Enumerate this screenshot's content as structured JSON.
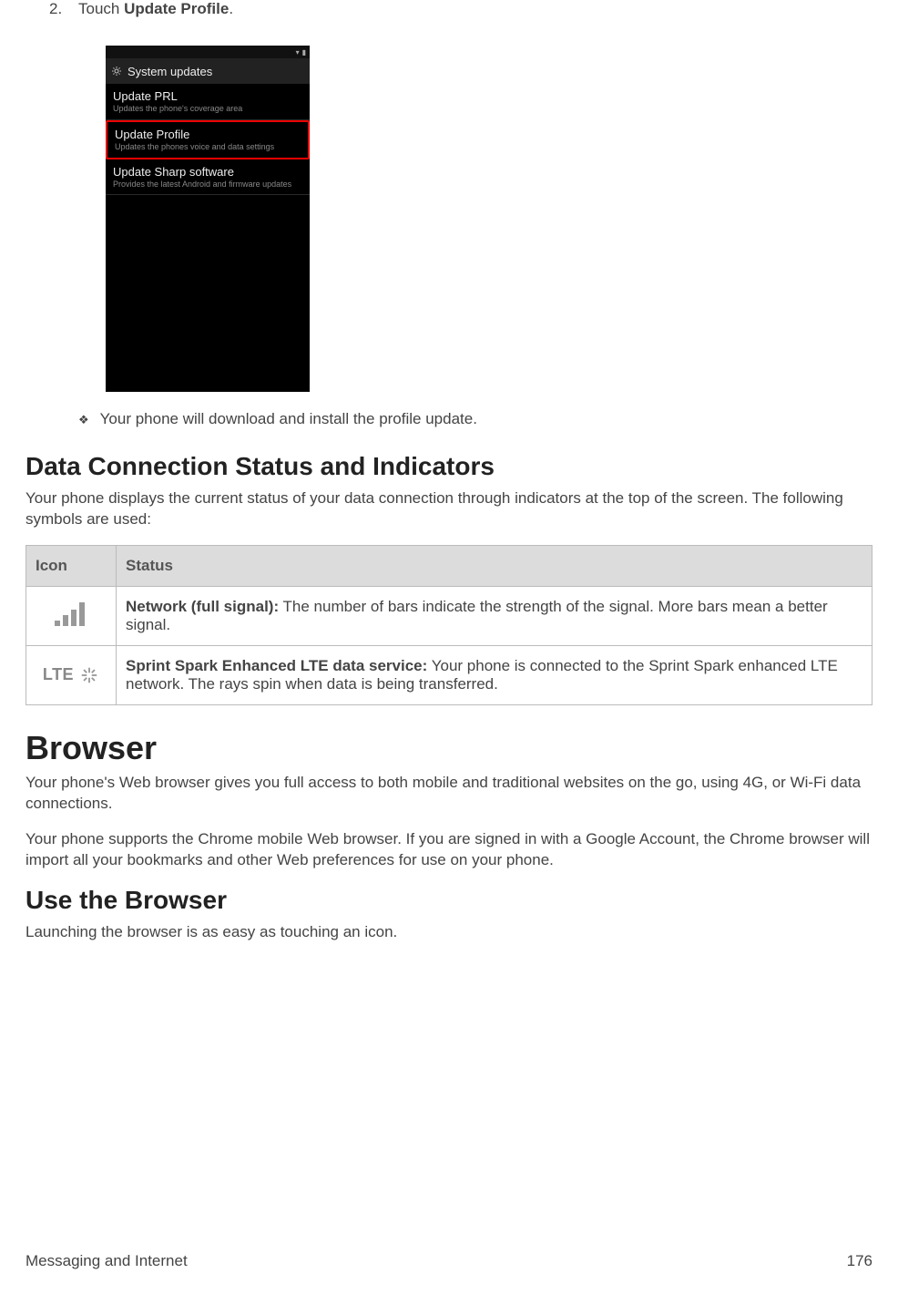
{
  "step": {
    "number": "2.",
    "prefix": "Touch ",
    "bold": "Update Profile",
    "suffix": "."
  },
  "phone": {
    "header": "System updates",
    "items": [
      {
        "title": "Update PRL",
        "sub": "Updates the phone's coverage area"
      },
      {
        "title": "Update Profile",
        "sub": "Updates the phones voice and data settings"
      },
      {
        "title": "Update Sharp software",
        "sub": "Provides the latest Android and firmware updates"
      }
    ]
  },
  "bullet": "Your phone will download and install the profile update.",
  "h2_data": "Data Connection Status and Indicators",
  "p_data": "Your phone displays the current status of your data connection through indicators at the top of the screen. The following symbols are used:",
  "table": {
    "headers": {
      "icon": "Icon",
      "status": "Status"
    },
    "rows": [
      {
        "label": "Network (full signal):",
        "desc": " The number of bars indicate the strength of the signal. More bars mean a better signal."
      },
      {
        "lte": "LTE",
        "label": "Sprint Spark Enhanced LTE data service:",
        "desc": " Your phone is connected to the Sprint Spark enhanced LTE network. The rays spin when data is being transferred."
      }
    ]
  },
  "h1_browser": "Browser",
  "p_browser1": "Your phone's Web browser gives you full access to both mobile and traditional websites on the go, using 4G, or Wi-Fi data connections.",
  "p_browser2": "Your phone supports the Chrome mobile Web browser. If you are signed in with a Google Account, the Chrome browser will import all your bookmarks and other Web preferences for use on your phone.",
  "h2_use": "Use the Browser",
  "p_use": "Launching the browser is as easy as touching an icon.",
  "footer": {
    "left": "Messaging and Internet",
    "right": "176"
  }
}
